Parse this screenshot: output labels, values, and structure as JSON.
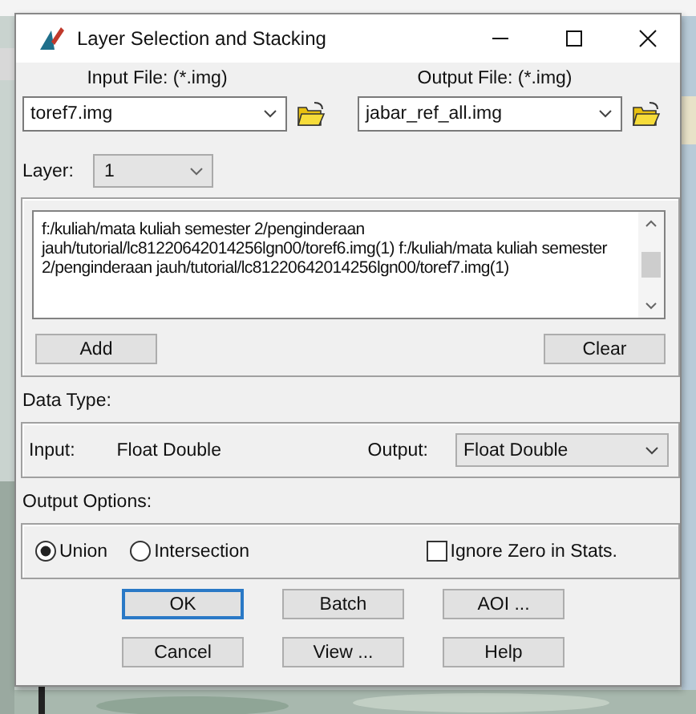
{
  "window": {
    "title": "Layer Selection and Stacking"
  },
  "input_file": {
    "label": "Input File: (*.img)",
    "value": "toref7.img"
  },
  "output_file": {
    "label": "Output File: (*.img)",
    "value": "jabar_ref_all.img"
  },
  "layer": {
    "label": "Layer:",
    "value": "1",
    "disabled": true
  },
  "file_list": {
    "text": "f:/kuliah/mata kuliah semester 2/penginderaan jauh/tutorial/lc81220642014256lgn00/toref6.img(1)   f:/kuliah/mata kuliah semester 2/penginderaan jauh/tutorial/lc81220642014256lgn00/toref7.img(1)",
    "add": "Add",
    "clear": "Clear"
  },
  "data_type": {
    "label": "Data Type:",
    "input_label": "Input:",
    "input_value": "Float Double",
    "output_label": "Output:",
    "output_value": "Float Double"
  },
  "output_options": {
    "label": "Output Options:",
    "options": [
      {
        "label": "Union",
        "selected": true
      },
      {
        "label": "Intersection",
        "selected": false
      }
    ],
    "ignore_zero": {
      "label": "Ignore Zero in Stats.",
      "checked": false
    }
  },
  "buttons": [
    {
      "label": "OK",
      "default": true
    },
    {
      "label": "Batch",
      "default": false
    },
    {
      "label": "AOI ...",
      "default": false
    },
    {
      "label": "Cancel",
      "default": false
    },
    {
      "label": "View ...",
      "default": false
    },
    {
      "label": "Help",
      "default": false
    }
  ]
}
